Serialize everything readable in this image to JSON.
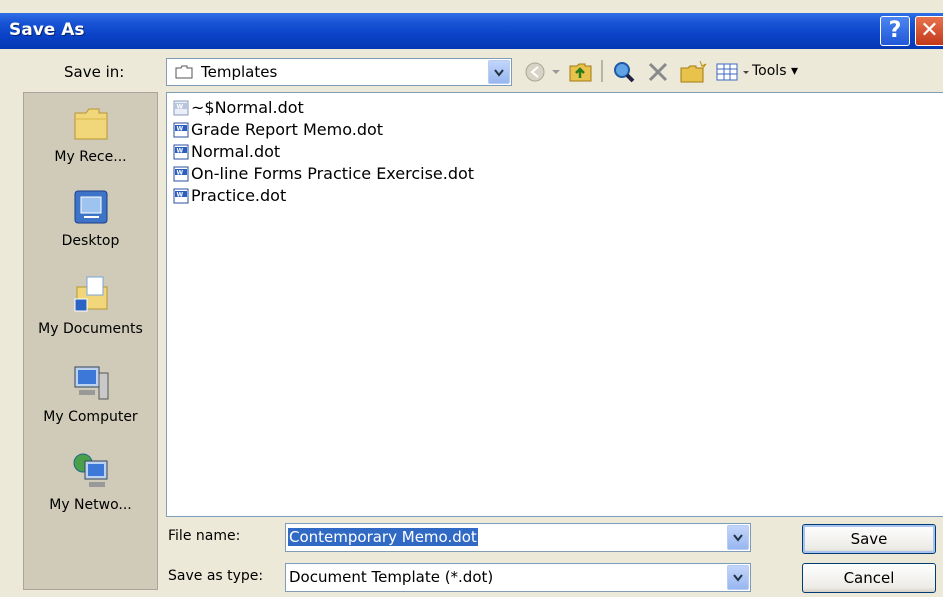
{
  "window": {
    "title": "Save As"
  },
  "titlebar": {
    "help_glyph": "?",
    "close_glyph": "✕"
  },
  "toolbar": {
    "save_in_label": "Save in:",
    "save_in_value": "Templates",
    "tools_label": "Tools ▾"
  },
  "places": [
    {
      "label": "My Rece...",
      "icon": "recent-folder-icon"
    },
    {
      "label": "Desktop",
      "icon": "desktop-icon"
    },
    {
      "label": "My Documents",
      "icon": "my-documents-icon"
    },
    {
      "label": "My Computer",
      "icon": "my-computer-icon"
    },
    {
      "label": "My Netwo...",
      "icon": "network-icon"
    }
  ],
  "files": [
    {
      "name": "~$Normal.dot",
      "icon": "word-template-icon"
    },
    {
      "name": "Grade Report Memo.dot",
      "icon": "word-template-icon"
    },
    {
      "name": "Normal.dot",
      "icon": "word-template-icon"
    },
    {
      "name": "On-line Forms Practice Exercise.dot",
      "icon": "word-template-icon"
    },
    {
      "name": "Practice.dot",
      "icon": "word-template-icon"
    }
  ],
  "form": {
    "file_name_label": "File name:",
    "file_name_value": "Contemporary Memo.dot",
    "save_as_type_label": "Save as type:",
    "save_as_type_value": "Document Template (*.dot)"
  },
  "buttons": {
    "save": "Save",
    "cancel": "Cancel"
  }
}
